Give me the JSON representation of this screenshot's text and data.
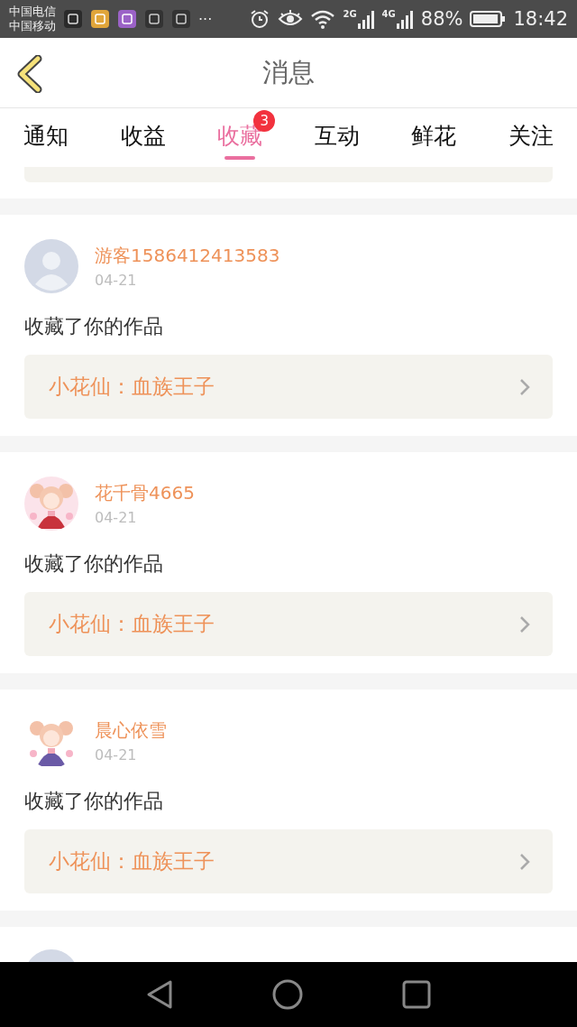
{
  "status_bar": {
    "carriers": [
      "中国电信",
      "中国移动"
    ],
    "more": "···",
    "networks": [
      "2G",
      "4G"
    ],
    "battery": "88%",
    "time": "18:42"
  },
  "header": {
    "title": "消息"
  },
  "tabs": [
    {
      "label": "通知",
      "selected": false
    },
    {
      "label": "收益",
      "selected": false
    },
    {
      "label": "收藏",
      "selected": true,
      "badge": "3"
    },
    {
      "label": "互动",
      "selected": false
    },
    {
      "label": "鲜花",
      "selected": false
    },
    {
      "label": "关注",
      "selected": false
    }
  ],
  "messages": [
    {
      "user": "游客1586412413583",
      "date": "04-21",
      "kind": "silhouette",
      "text": "收藏了你的作品",
      "work": "小花仙：血族王子"
    },
    {
      "user": "花千骨4665",
      "date": "04-21",
      "kind": "picture",
      "text": "收藏了你的作品",
      "work": "小花仙：血族王子"
    },
    {
      "user": "晨心依雪",
      "date": "04-21",
      "kind": "picture",
      "text": "收藏了你的作品",
      "work": "小花仙：血族王子"
    }
  ],
  "partial_message": {
    "kind": "silhouette"
  }
}
